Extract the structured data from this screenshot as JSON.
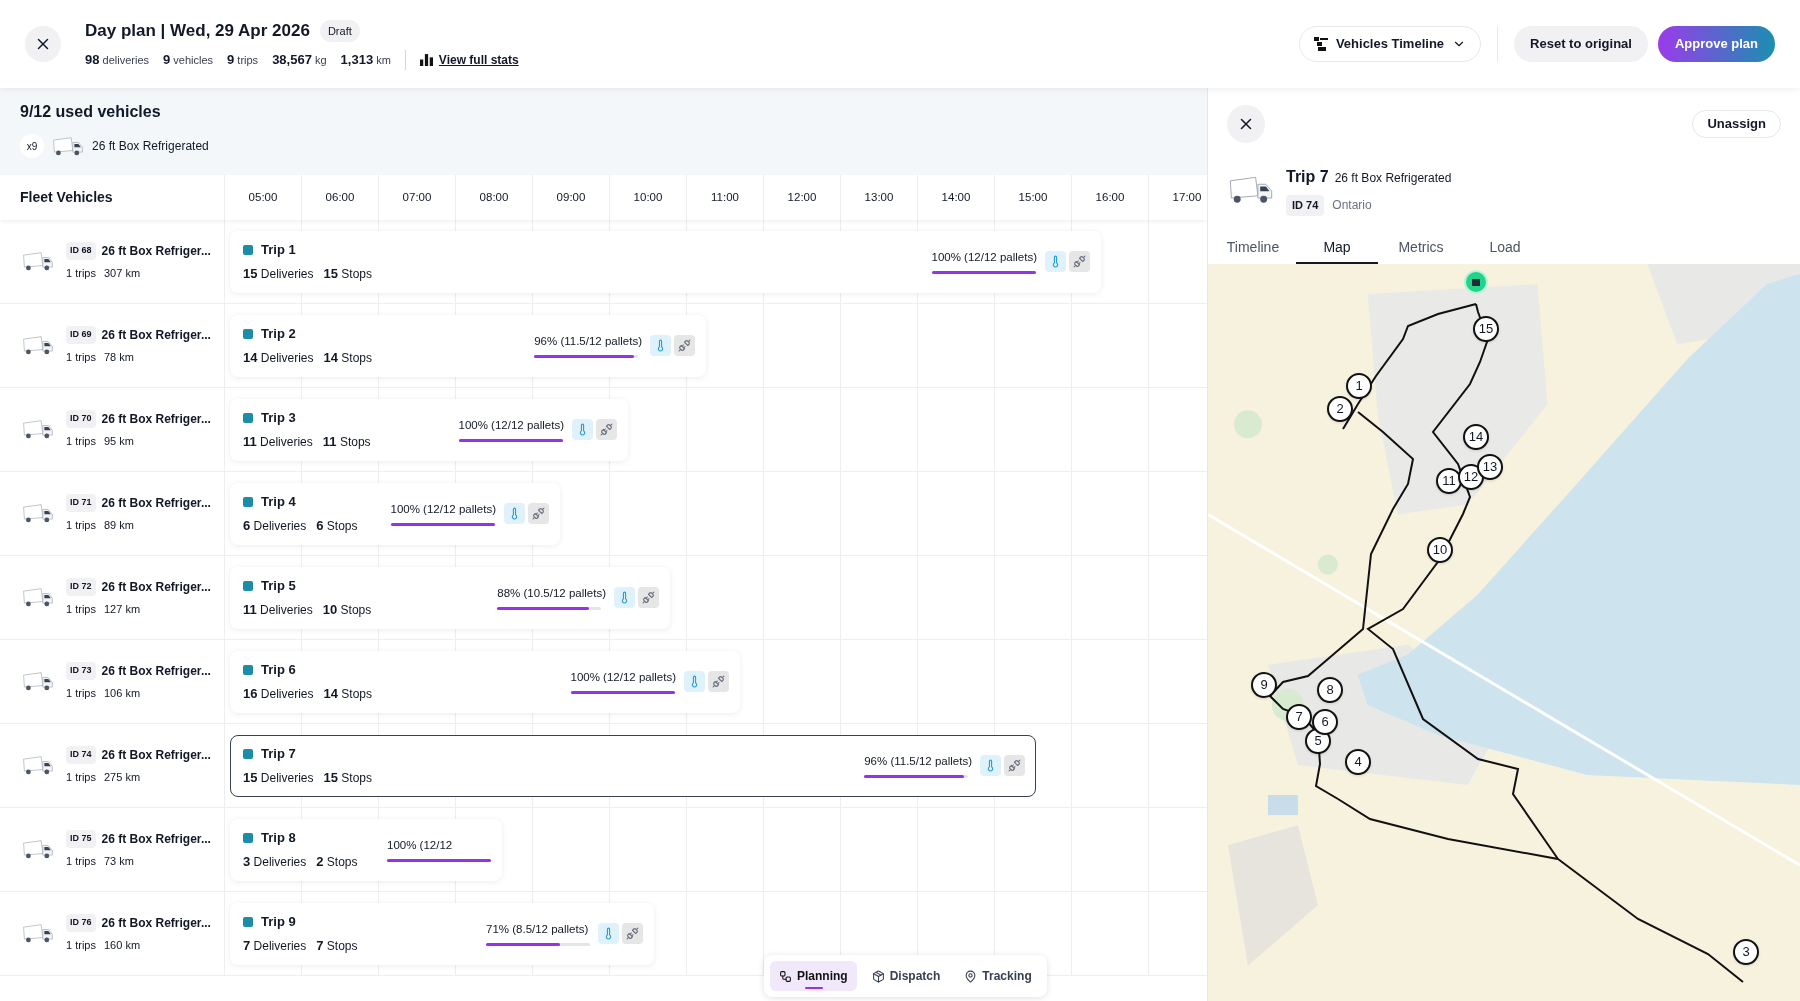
{
  "header": {
    "title": "Day plan | Wed, 29 Apr 2026",
    "status_badge": "Draft",
    "stats": [
      {
        "value": "98",
        "unit": "deliveries"
      },
      {
        "value": "9",
        "unit": "vehicles"
      },
      {
        "value": "9",
        "unit": "trips"
      },
      {
        "value": "38,567",
        "unit": "kg"
      },
      {
        "value": "1,313",
        "unit": "km"
      }
    ],
    "stats_link": "View full stats",
    "view_selector": "Vehicles Timeline",
    "reset_button": "Reset to original",
    "approve_button": "Approve plan"
  },
  "summary": {
    "title": "9/12 used vehicles",
    "vehicle_types": [
      {
        "count": "x9",
        "name": "26 ft Box Refrigerated"
      }
    ]
  },
  "timeline": {
    "column_title": "Fleet Vehicles",
    "hours": [
      "05:00",
      "06:00",
      "07:00",
      "08:00",
      "09:00",
      "10:00",
      "11:00",
      "12:00",
      "13:00",
      "14:00",
      "15:00",
      "16:00",
      "17:00"
    ],
    "rows": [
      {
        "vehicle_id": "ID 68",
        "vehicle_name": "26 ft Box Refriger...",
        "trips": "1 trips",
        "distance": "307 km",
        "trip": {
          "name": "Trip 1",
          "deliveries": "15",
          "deliveries_label": "Deliveries",
          "stops": "15",
          "stops_label": "Stops",
          "load_text": "100% (12/12 pallets)",
          "level": 1,
          "selected": false,
          "icons_visible": true
        }
      },
      {
        "vehicle_id": "ID 69",
        "vehicle_name": "26 ft Box Refriger...",
        "trips": "1 trips",
        "distance": "78 km",
        "trip": {
          "name": "Trip 2",
          "deliveries": "14",
          "deliveries_label": "Deliveries",
          "stops": "14",
          "stops_label": "Stops",
          "load_text": "96% (11.5/12 pallets)",
          "level": 0.96,
          "selected": false,
          "icons_visible": true
        }
      },
      {
        "vehicle_id": "ID 70",
        "vehicle_name": "26 ft Box Refriger...",
        "trips": "1 trips",
        "distance": "95 km",
        "trip": {
          "name": "Trip 3",
          "deliveries": "11",
          "deliveries_label": "Deliveries",
          "stops": "11",
          "stops_label": "Stops",
          "load_text": "100% (12/12 pallets)",
          "level": 1,
          "selected": false,
          "icons_visible": true
        }
      },
      {
        "vehicle_id": "ID 71",
        "vehicle_name": "26 ft Box Refriger...",
        "trips": "1 trips",
        "distance": "89 km",
        "trip": {
          "name": "Trip 4",
          "deliveries": "6",
          "deliveries_label": "Deliveries",
          "stops": "6",
          "stops_label": "Stops",
          "load_text": "100% (12/12 pallets)",
          "level": 1,
          "selected": false,
          "icons_visible": true
        }
      },
      {
        "vehicle_id": "ID 72",
        "vehicle_name": "26 ft Box Refriger...",
        "trips": "1 trips",
        "distance": "127 km",
        "trip": {
          "name": "Trip 5",
          "deliveries": "11",
          "deliveries_label": "Deliveries",
          "stops": "10",
          "stops_label": "Stops",
          "load_text": "88% (10.5/12 pallets)",
          "level": 0.88,
          "selected": false,
          "icons_visible": true
        }
      },
      {
        "vehicle_id": "ID 73",
        "vehicle_name": "26 ft Box Refriger...",
        "trips": "1 trips",
        "distance": "106 km",
        "trip": {
          "name": "Trip 6",
          "deliveries": "16",
          "deliveries_label": "Deliveries",
          "stops": "14",
          "stops_label": "Stops",
          "load_text": "100% (12/12 pallets)",
          "level": 1,
          "selected": false,
          "icons_visible": true
        }
      },
      {
        "vehicle_id": "ID 74",
        "vehicle_name": "26 ft Box Refriger...",
        "trips": "1 trips",
        "distance": "275 km",
        "trip": {
          "name": "Trip 7",
          "deliveries": "15",
          "deliveries_label": "Deliveries",
          "stops": "15",
          "stops_label": "Stops",
          "load_text": "96% (11.5/12 pallets)",
          "level": 0.96,
          "selected": true,
          "icons_visible": true
        }
      },
      {
        "vehicle_id": "ID 75",
        "vehicle_name": "26 ft Box Refriger...",
        "trips": "1 trips",
        "distance": "73 km",
        "trip": {
          "name": "Trip 8",
          "deliveries": "3",
          "deliveries_label": "Deliveries",
          "stops": "2",
          "stops_label": "Stops",
          "load_text": "100% (12/12",
          "level": 1,
          "selected": false,
          "icons_visible": false
        }
      },
      {
        "vehicle_id": "ID 76",
        "vehicle_name": "26 ft Box Refriger...",
        "trips": "1 trips",
        "distance": "160 km",
        "trip": {
          "name": "Trip 9",
          "deliveries": "7",
          "deliveries_label": "Deliveries",
          "stops": "7",
          "stops_label": "Stops",
          "load_text": "71% (8.5/12 pallets)",
          "level": 0.71,
          "selected": false,
          "icons_visible": true
        }
      }
    ]
  },
  "bottom_nav": [
    {
      "label": "Planning",
      "selected": true
    },
    {
      "label": "Dispatch",
      "selected": false
    },
    {
      "label": "Tracking",
      "selected": false
    }
  ],
  "detail_panel": {
    "unassign_button": "Unassign",
    "trip_name": "Trip 7",
    "vehicle_type": "26 ft Box Refrigerated",
    "vehicle_id": "ID 74",
    "region": "Ontario",
    "tabs": [
      {
        "label": "Timeline",
        "selected": false
      },
      {
        "label": "Map",
        "selected": true
      },
      {
        "label": "Metrics",
        "selected": false
      },
      {
        "label": "Load",
        "selected": false
      }
    ],
    "map": {
      "stop_markers": [
        "1",
        "2",
        "3",
        "4",
        "5",
        "6",
        "7",
        "8",
        "9",
        "10",
        "11",
        "12",
        "13",
        "14",
        "15"
      ]
    }
  }
}
